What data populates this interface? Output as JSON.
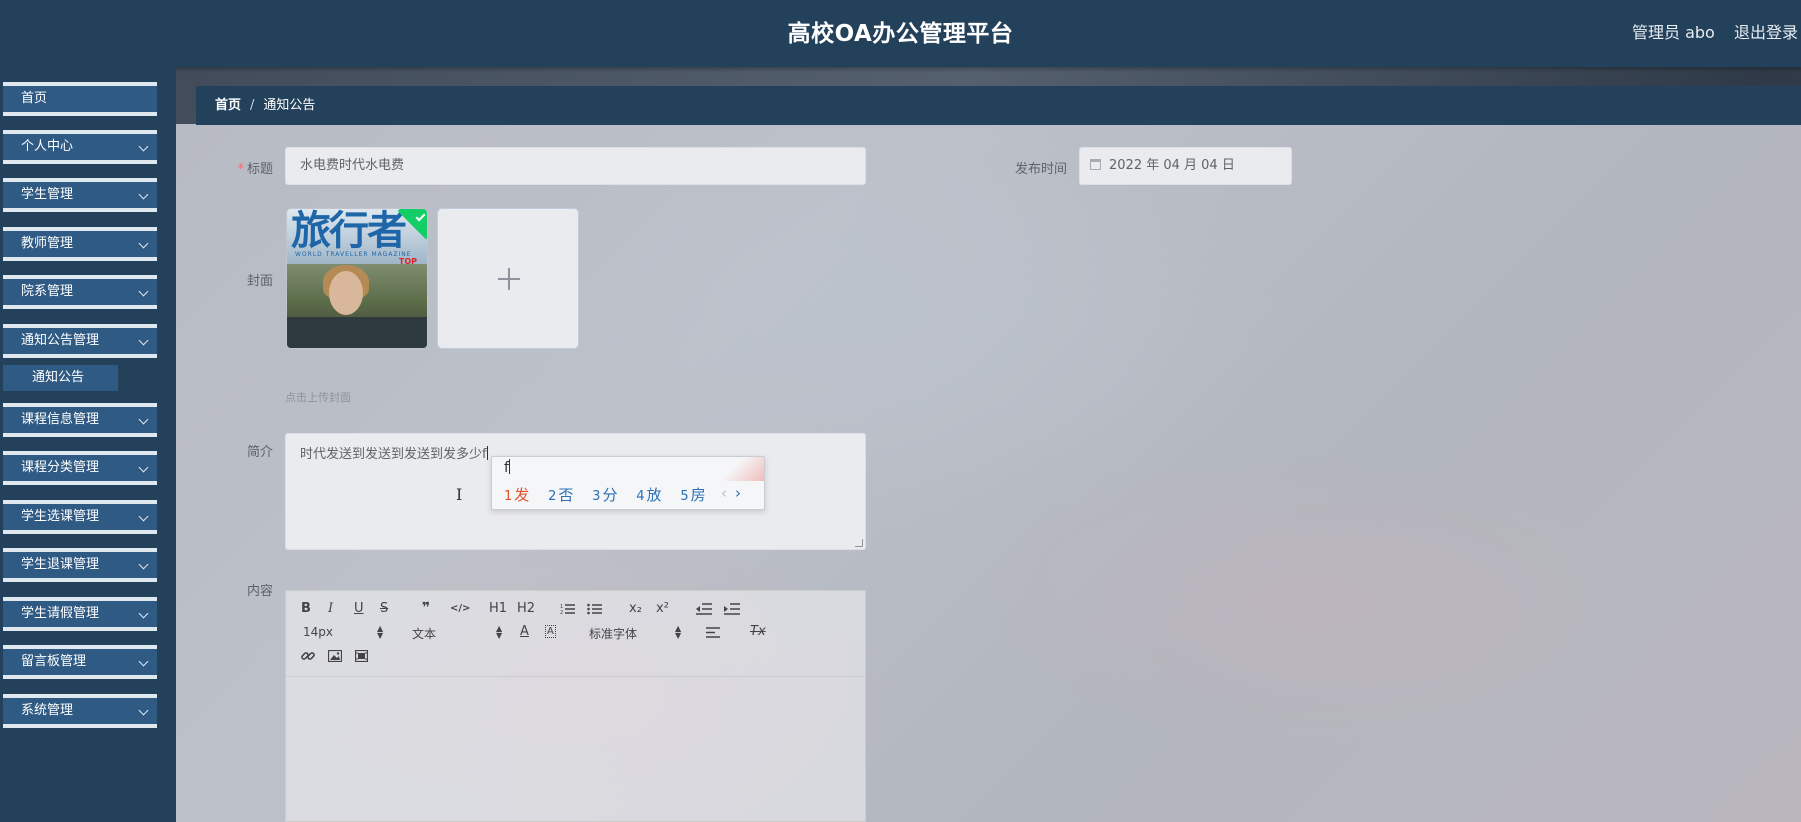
{
  "header": {
    "title": "高校OA办公管理平台",
    "admin": "管理员 abo",
    "logout": "退出登录"
  },
  "sidebar": {
    "items": [
      {
        "label": "首页",
        "has_chevron": false
      },
      {
        "label": "个人中心",
        "has_chevron": true
      },
      {
        "label": "学生管理",
        "has_chevron": true
      },
      {
        "label": "教师管理",
        "has_chevron": true
      },
      {
        "label": "院系管理",
        "has_chevron": true
      },
      {
        "label": "通知公告管理",
        "has_chevron": true
      },
      {
        "label": "课程信息管理",
        "has_chevron": true
      },
      {
        "label": "课程分类管理",
        "has_chevron": true
      },
      {
        "label": "学生选课管理",
        "has_chevron": true
      },
      {
        "label": "学生退课管理",
        "has_chevron": true
      },
      {
        "label": "学生请假管理",
        "has_chevron": true
      },
      {
        "label": "留言板管理",
        "has_chevron": true
      },
      {
        "label": "系统管理",
        "has_chevron": true
      }
    ],
    "active_sub": "通知公告"
  },
  "breadcrumb": {
    "home": "首页",
    "separator": "/",
    "current": "通知公告"
  },
  "form": {
    "title_label": "标题",
    "title_required_mark": "*",
    "title_value": "水电费时代水电费",
    "publish_label": "发布时间",
    "publish_value": "2022 年 04 月 04 日",
    "cover_label": "封面",
    "cover_image": {
      "title_text": "旅行者",
      "subtitle": "WORLD TRAVELLER MAGAZINE",
      "badge": "TOP"
    },
    "upload_hint": "点击上传封面",
    "summary_label": "简介",
    "summary_value": "时代发送到发送到发送到发多少f",
    "content_label": "内容"
  },
  "ime": {
    "composition": "f",
    "candidates": [
      {
        "num": "1",
        "char": "发"
      },
      {
        "num": "2",
        "char": "否"
      },
      {
        "num": "3",
        "char": "分"
      },
      {
        "num": "4",
        "char": "放"
      },
      {
        "num": "5",
        "char": "房"
      }
    ],
    "prev": "‹",
    "next": "›"
  },
  "editor": {
    "font_size": "14px",
    "block_format": "文本",
    "font_family": "标准字体",
    "buttons": {
      "bold": "B",
      "italic": "I",
      "underline": "U",
      "strike": "S",
      "quote": "❞",
      "code": "</>",
      "h1": "H1",
      "h2": "H2",
      "sub": "x₂",
      "sup": "x²",
      "font_color": "A",
      "clean": "Tx"
    }
  },
  "colors": {
    "header_bg": "#24415c",
    "menu_bg": "#2e5a84",
    "required": "#f56c6c",
    "success": "#13ce66"
  }
}
